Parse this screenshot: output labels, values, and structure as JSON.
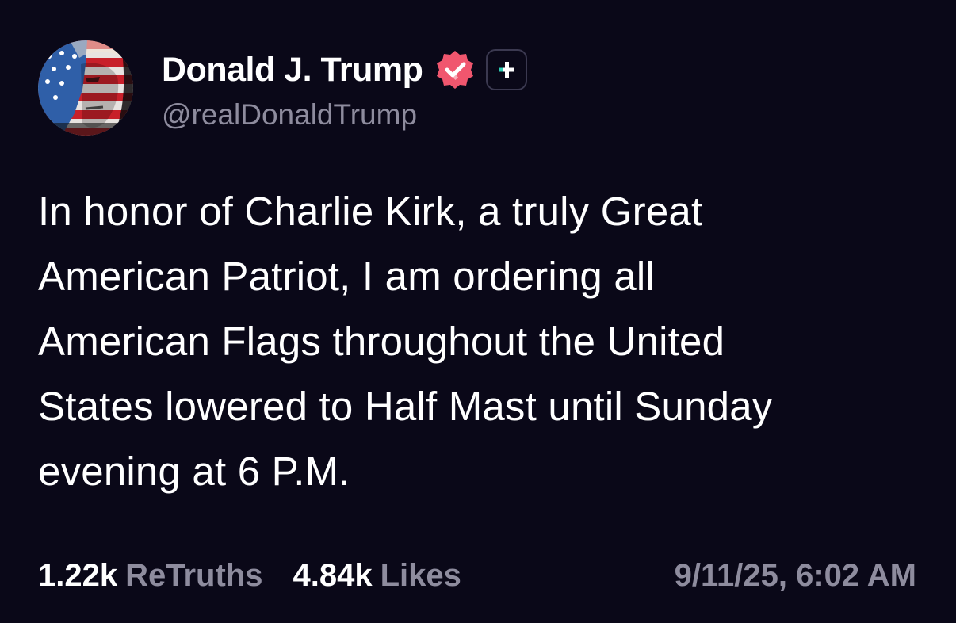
{
  "post": {
    "author": {
      "display_name": "Donald J. Trump",
      "handle": "@realDonaldTrump",
      "verified": true,
      "verified_color": "#f0566e",
      "plus_badge_color": "#2ecdb4"
    },
    "body_lines": [
      "In honor of Charlie Kirk, a truly Great",
      "American Patriot, I am ordering all",
      "American Flags throughout the United",
      "States lowered to Half Mast until Sunday",
      "evening at 6 P.M."
    ],
    "stats": {
      "retruths_count": "1.22k",
      "retruths_label": "ReTruths",
      "likes_count": "4.84k",
      "likes_label": "Likes"
    },
    "timestamp": "9/11/25, 6:02 AM"
  },
  "colors": {
    "background": "#0a0818",
    "text_primary": "#ffffff",
    "text_secondary": "#8e8c9e"
  },
  "icons": {
    "verified": "verified-badge-icon",
    "plus": "plus-badge-icon",
    "avatar": "flag-portrait-avatar"
  }
}
